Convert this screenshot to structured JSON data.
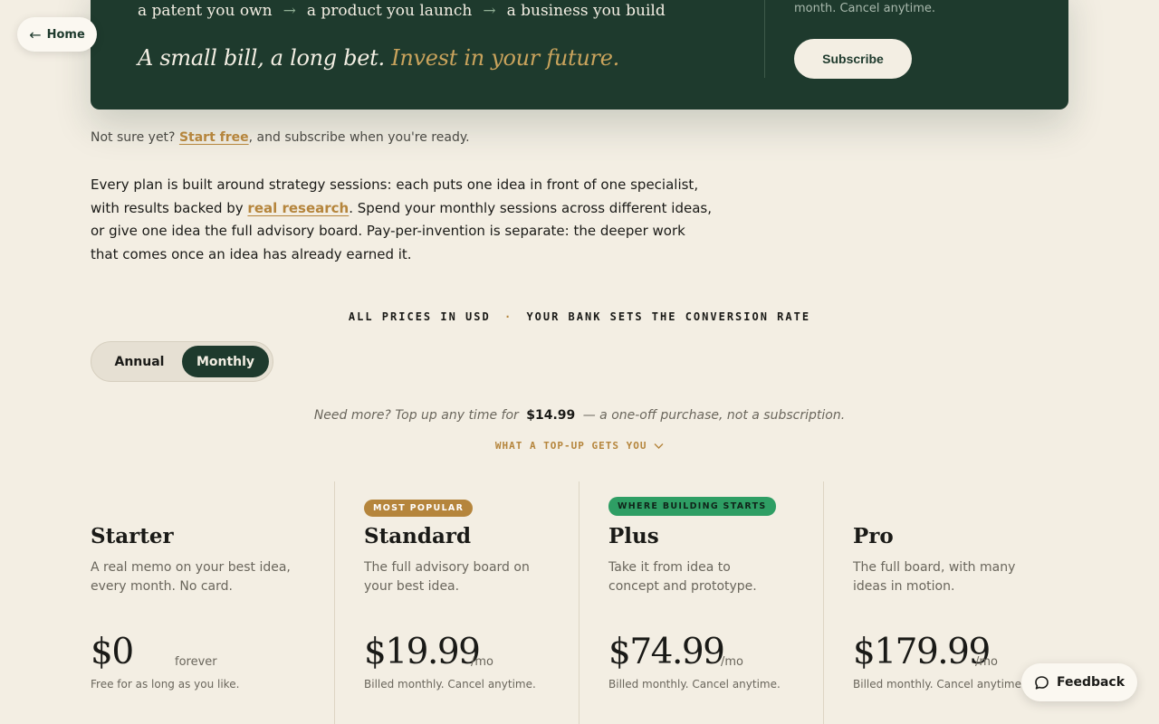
{
  "hero": {
    "path": [
      "a patent you own",
      "a product you launch",
      "a business you build"
    ],
    "arrow": "→",
    "tagline_main": "A small bill, a long bet.",
    "tagline_accent": "Invest in your future.",
    "note": "month. Cancel anytime.",
    "subscribe_label": "Subscribe"
  },
  "nav": {
    "home_arrow": "←",
    "home_label": "Home"
  },
  "not_sure": {
    "prefix": "Not sure yet?",
    "link": "Start free",
    "suffix": ", and subscribe when you're ready."
  },
  "intro": {
    "before_link": "Every plan is built around strategy sessions: each puts one idea in front of one specialist, with results backed by ",
    "link": "real research",
    "after_link": ". Spend your monthly sessions across different ideas, or give one idea the full advisory board. Pay-per-invention is separate: the deeper work that comes once an idea has already earned it."
  },
  "prices_note": {
    "left": "ALL PRICES IN USD",
    "dot": "·",
    "right": "YOUR BANK SETS THE CONVERSION RATE"
  },
  "billing_toggle": {
    "annual": "Annual",
    "monthly": "Monthly",
    "selected": "Monthly"
  },
  "topup": {
    "before": "Need more? Top up any time for",
    "price": "$14.99",
    "after": "— a one-off purchase, not a subscription.",
    "link": "WHAT A TOP-UP GETS YOU"
  },
  "plans": [
    {
      "badge": "",
      "name": "Starter",
      "desc": "A real memo on your best idea, every month. No card.",
      "price": "$0",
      "unit": "forever",
      "bill": "Free for as long as you like."
    },
    {
      "badge": "MOST POPULAR",
      "badge_color": "#b5853c",
      "name": "Standard",
      "desc": "The full advisory board on your best idea.",
      "price": "$19.99",
      "unit": "/mo",
      "bill": "Billed monthly. Cancel anytime."
    },
    {
      "badge": "WHERE BUILDING STARTS",
      "badge_color": "#2e9e64",
      "name": "Plus",
      "desc": "Take it from idea to concept and prototype.",
      "price": "$74.99",
      "unit": "/mo",
      "bill": "Billed monthly. Cancel anytime."
    },
    {
      "badge": "",
      "name": "Pro",
      "desc": "The full board, with many ideas in motion.",
      "price": "$179.99",
      "unit": "/mo",
      "bill": "Billed monthly. Cancel anytime."
    }
  ],
  "feedback": {
    "label": "Feedback"
  }
}
